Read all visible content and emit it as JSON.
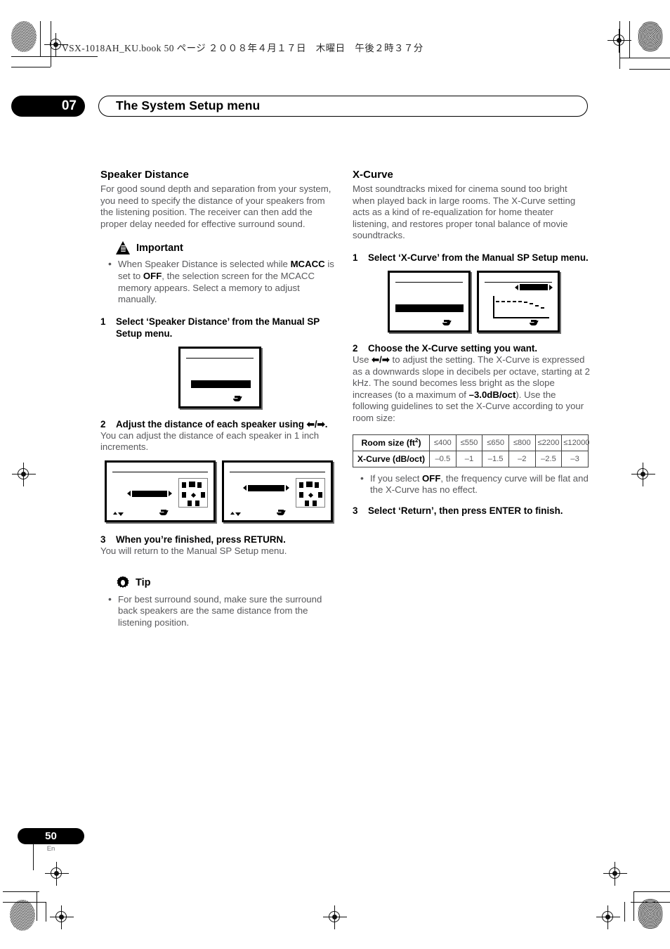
{
  "print_header": {
    "book_line": "VSX-1018AH_KU.book   50 ページ   ２００８年４月１７日　木曜日　午後２時３７分"
  },
  "chapter": {
    "number": "07",
    "title": "The System Setup menu"
  },
  "left_column": {
    "section_title": "Speaker Distance",
    "intro": "For good sound depth and separation from your system, you need to specify the distance of your speakers from the listening position. The receiver can then add the proper delay needed for effective surround sound.",
    "important": {
      "icon": "warning-triangle-icon",
      "label": "Important",
      "bullets": [
        {
          "parts": [
            {
              "t": "When Speaker Distance is selected while ",
              "bold": false
            },
            {
              "t": "MCACC",
              "bold": true
            },
            {
              "t": " is set to ",
              "bold": false
            },
            {
              "t": "OFF",
              "bold": true
            },
            {
              "t": ", the selection screen for the MCACC memory appears. Select a memory to adjust manually.",
              "bold": false
            }
          ]
        }
      ]
    },
    "steps": [
      {
        "num": "1",
        "heading": "Select ‘Speaker Distance’ from the Manual SP Setup menu.",
        "body": ""
      },
      {
        "num": "2",
        "heading": "Adjust the distance of each speaker using ⬅/➡.",
        "body": "You can adjust the distance of each speaker in 1 inch increments."
      },
      {
        "num": "3",
        "heading": "When you’re finished, press RETURN.",
        "body": "You will return to the Manual SP Setup menu."
      }
    ],
    "tip": {
      "icon": "gear-icon",
      "label": "Tip",
      "bullets": [
        {
          "parts": [
            {
              "t": "For best surround sound, make sure the surround back speakers are the same distance from the listening position.",
              "bold": false
            }
          ]
        }
      ]
    },
    "screens": {
      "mcacc_memory_select": {
        "name": "osd-mcacc-memory-select"
      },
      "manual_sp_menu": {
        "name": "osd-manual-sp-setup-menu"
      },
      "distance_a": {
        "name": "osd-speaker-distance-a"
      },
      "distance_b": {
        "name": "osd-speaker-distance-b"
      }
    }
  },
  "right_column": {
    "section_title": "X-Curve",
    "intro": "Most soundtracks mixed for cinema sound too bright when played back in large rooms. The X-Curve setting acts as a kind of re-equalization for home theater listening, and restores proper tonal balance of movie soundtracks.",
    "steps": [
      {
        "num": "1",
        "heading": "Select ‘X-Curve’ from the Manual SP Setup menu.",
        "body": ""
      },
      {
        "num": "2",
        "heading": "Choose the X-Curve setting you want.",
        "body_parts": [
          {
            "t": "Use ",
            "bold": false
          },
          {
            "t": "⬅/➡",
            "bold": true
          },
          {
            "t": " to adjust the setting. The X-Curve is expressed as a downwards slope in decibels per octave, starting at 2 kHz. The sound becomes less bright as the slope increases (to a maximum of ",
            "bold": false
          },
          {
            "t": "–3.0dB/oct",
            "bold": true
          },
          {
            "t": "). Use the following guidelines to set the X-Curve according to your room size:",
            "bold": false
          }
        ]
      },
      {
        "num": "3",
        "heading": "Select ‘Return’, then press ENTER to finish.",
        "body": ""
      }
    ],
    "table": {
      "row_headers": [
        "Room size (ft",
        "X-Curve (dB/oct)"
      ],
      "room_header_label": "Room size (ft",
      "room_header_sup": "2",
      "room_header_tail": ")",
      "xcurve_header": "X-Curve (dB/oct)",
      "room_sizes": [
        "≤400",
        "≤550",
        "≤650",
        "≤800",
        "≤2200",
        "≤12000"
      ],
      "xcurve_values": [
        "–0.5",
        "–1",
        "–1.5",
        "–2",
        "–2.5",
        "–3"
      ]
    },
    "bullets": [
      {
        "parts": [
          {
            "t": "If you select ",
            "bold": false
          },
          {
            "t": "OFF",
            "bold": true
          },
          {
            "t": ", the frequency curve will be flat and the X-Curve has no effect.",
            "bold": false
          }
        ]
      }
    ],
    "screens": {
      "manual_sp_menu": {
        "name": "osd-manual-sp-setup-menu-xcurve"
      },
      "xcurve_graph": {
        "name": "osd-xcurve-graph"
      }
    }
  },
  "footer": {
    "page_number": "50",
    "language": "En"
  },
  "colors": {
    "ink_black": "#000000",
    "body_gray": "#58585b",
    "rule_gray": "#404040"
  }
}
